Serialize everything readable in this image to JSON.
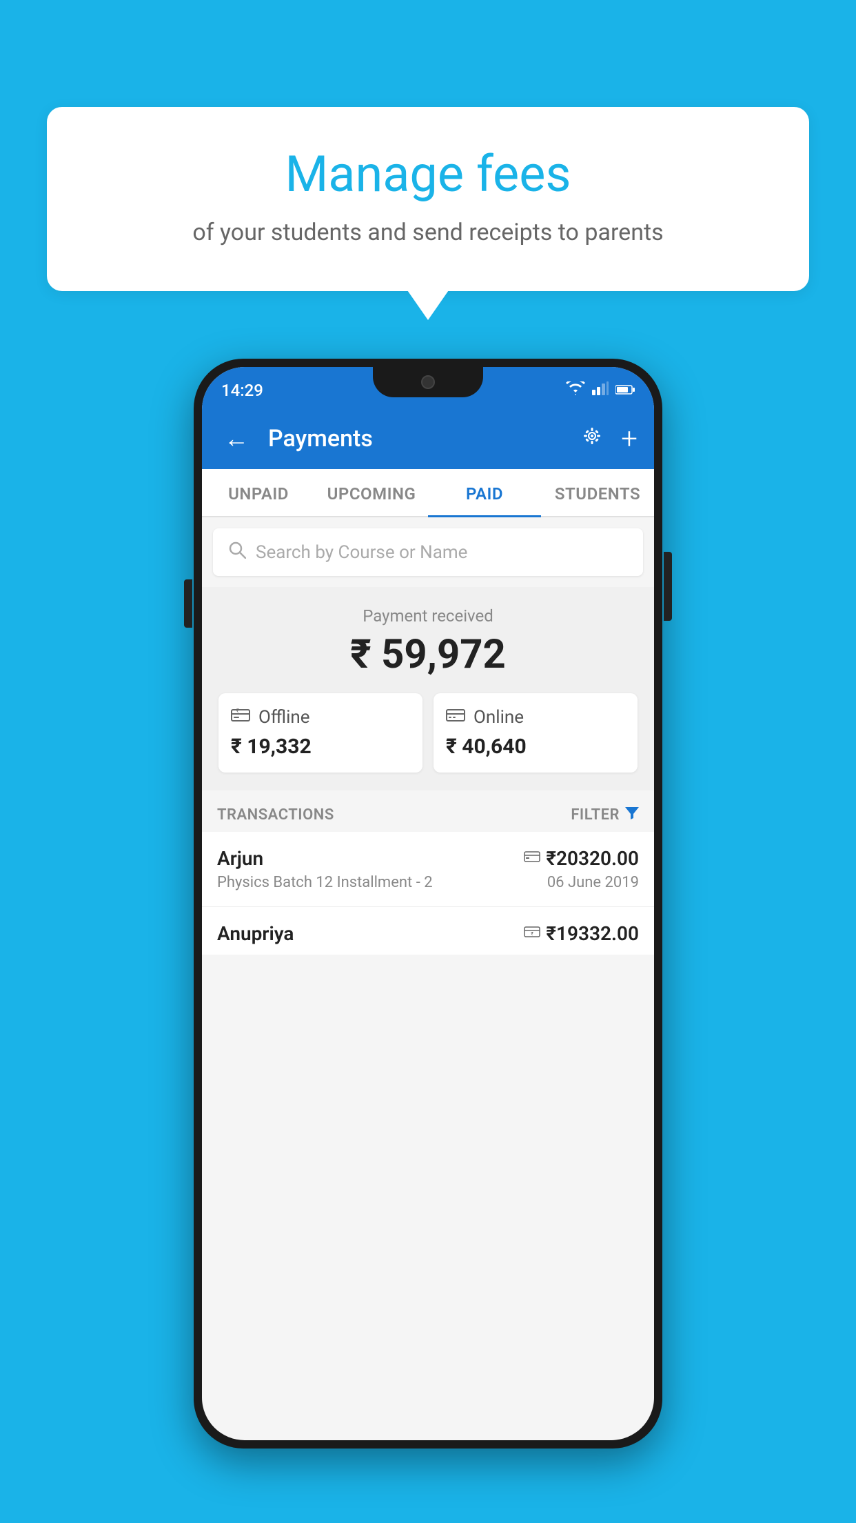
{
  "background_color": "#1ab3e8",
  "speech_bubble": {
    "title": "Manage fees",
    "subtitle": "of your students and send receipts to parents"
  },
  "phone": {
    "status_bar": {
      "time": "14:29",
      "icons": [
        "wifi",
        "signal",
        "battery"
      ]
    },
    "app_bar": {
      "title": "Payments",
      "back_label": "←",
      "gear_label": "⚙",
      "plus_label": "+"
    },
    "tabs": [
      {
        "label": "UNPAID",
        "active": false
      },
      {
        "label": "UPCOMING",
        "active": false
      },
      {
        "label": "PAID",
        "active": true
      },
      {
        "label": "STUDENTS",
        "active": false
      }
    ],
    "search": {
      "placeholder": "Search by Course or Name"
    },
    "payment_summary": {
      "label": "Payment received",
      "amount": "₹ 59,972",
      "offline": {
        "icon": "💳",
        "label": "Offline",
        "amount": "₹ 19,332"
      },
      "online": {
        "icon": "🃏",
        "label": "Online",
        "amount": "₹ 40,640"
      }
    },
    "transactions_label": "TRANSACTIONS",
    "filter_label": "FILTER",
    "transactions": [
      {
        "name": "Arjun",
        "detail": "Physics Batch 12 Installment - 2",
        "amount": "₹20320.00",
        "date": "06 June 2019",
        "type": "online"
      },
      {
        "name": "Anupriya",
        "detail": "",
        "amount": "₹19332.00",
        "date": "",
        "type": "offline"
      }
    ]
  }
}
